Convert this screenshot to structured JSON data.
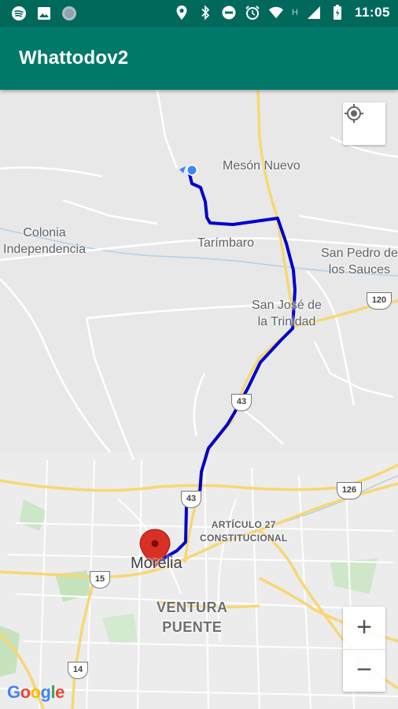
{
  "status_bar": {
    "time": "11:05",
    "network_indicator": "H",
    "left_icons": [
      "spotify-icon",
      "image-icon",
      "circle-app-icon"
    ],
    "right_icons": [
      "location-icon",
      "bluetooth-icon",
      "do-not-disturb-icon",
      "alarm-icon",
      "wifi-icon",
      "signal-icon",
      "battery-icon"
    ]
  },
  "app_bar": {
    "title": "Whattodov2"
  },
  "map": {
    "labels": {
      "meson_nuevo": "Mesón Nuevo",
      "colonia_independencia": "Colonia\nIndependencia",
      "tarimbaro": "Tarímbaro",
      "san_pedro": "San Pedro de\nlos Sauces",
      "san_jose": "San José de\nla Trinidad",
      "articulo_27": "ARTÍCULO 27\nCONSTITUCIONAL",
      "morelia": "Morelia",
      "ventura_puente": "VENTURA\nPUENTE"
    },
    "highway_shields": [
      "120",
      "43",
      "126",
      "43",
      "15",
      "14"
    ],
    "route_color": "#0000cc",
    "marker_color": "#d93025",
    "my_location_color": "#4285f4",
    "controls": {
      "zoom_in": "+",
      "zoom_out": "−"
    },
    "attribution": "Google"
  }
}
